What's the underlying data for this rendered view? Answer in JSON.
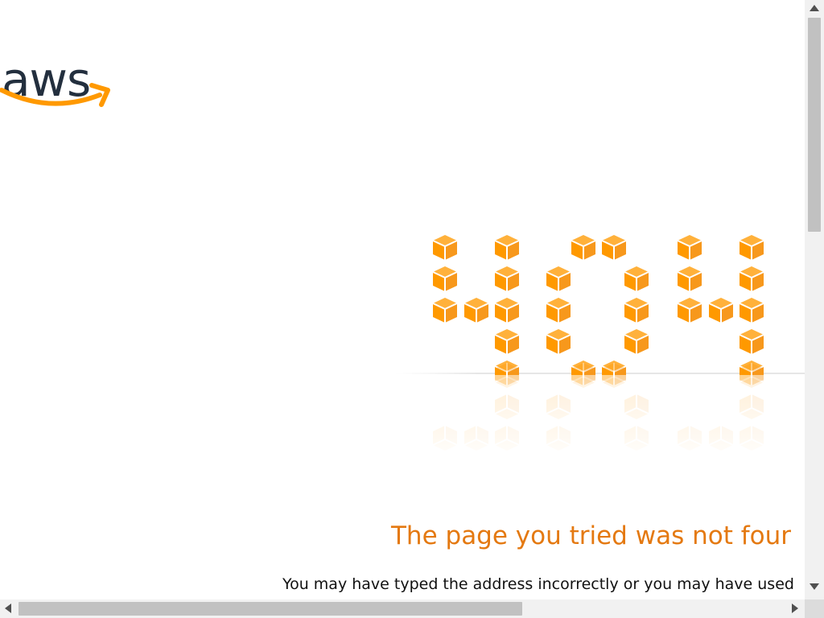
{
  "logo": {
    "text": "aws"
  },
  "art": {
    "icon": "404-cubes-icon"
  },
  "error": {
    "headline": "The page you tried was not four",
    "message": "You may have typed the address incorrectly or you may have used"
  },
  "colors": {
    "cube": "#ff9900",
    "headline": "#e47911",
    "logo_text": "#232f3e",
    "smile": "#ff9900"
  }
}
